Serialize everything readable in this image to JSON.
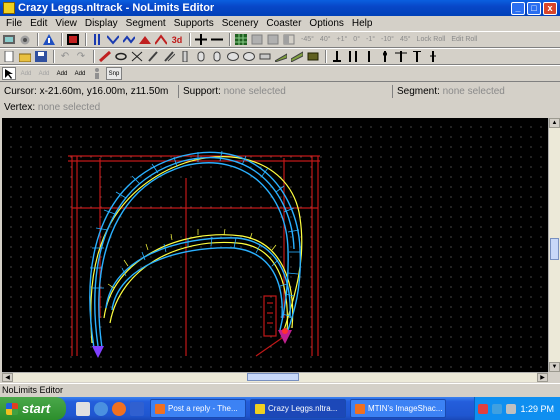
{
  "window": {
    "title": "Crazy Leggs.nltrack - NoLimits Editor",
    "min_label": "_",
    "max_label": "□",
    "close_label": "x"
  },
  "menu": [
    {
      "label": "File"
    },
    {
      "label": "Edit"
    },
    {
      "label": "View"
    },
    {
      "label": "Display"
    },
    {
      "label": "Segment"
    },
    {
      "label": "Supports"
    },
    {
      "label": "Scenery"
    },
    {
      "label": "Coaster"
    },
    {
      "label": "Options"
    },
    {
      "label": "Help"
    }
  ],
  "toolbar1": {
    "bank_labels": [
      "-45°",
      "40°",
      "+1°",
      "0°",
      "-1°",
      "-10°",
      "45°"
    ],
    "lock_label": "Lock Roll",
    "edit_label": "Edit Roll",
    "three_d_label": "3d"
  },
  "toolbar3": {
    "snap_label": "Snp",
    "add_labels": [
      "Add",
      "Add",
      "Add",
      "Add"
    ]
  },
  "status": {
    "cursor_label": "Cursor:",
    "cursor_value": "x-21.60m, y16.00m, z11.50m",
    "support_label": "Support:",
    "support_value": "none selected",
    "segment_label": "Segment:",
    "segment_value": "none selected",
    "vertex_label": "Vertex:",
    "vertex_value": "none selected"
  },
  "editor_status": "NoLimits Editor",
  "taskbar": {
    "start_label": "start",
    "tasks": [
      {
        "label": "Post a reply - The..."
      },
      {
        "label": "Crazy Leggs.nltra..."
      },
      {
        "label": "MTIN's ImageShac..."
      }
    ],
    "clock": "1:29 PM"
  },
  "colors": {
    "track_blue": "#2ab0ff",
    "track_yellow": "#ffff40",
    "support_red": "#c01818",
    "viewport_bg": "#000000"
  }
}
